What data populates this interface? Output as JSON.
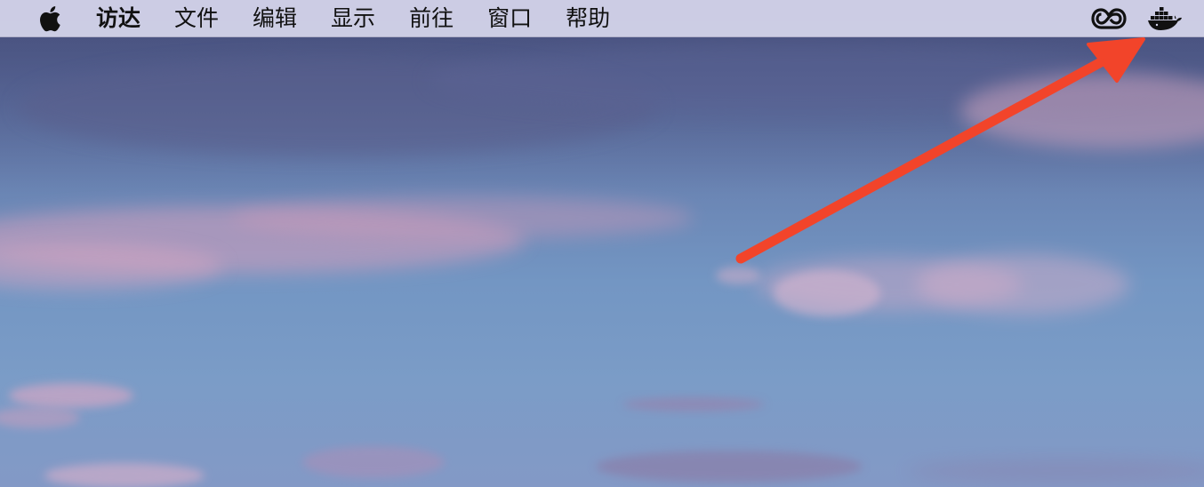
{
  "menubar": {
    "apple_menu_icon": "apple-logo-icon",
    "items": [
      {
        "label": "访达"
      },
      {
        "label": "文件"
      },
      {
        "label": "编辑"
      },
      {
        "label": "显示"
      },
      {
        "label": "前往"
      },
      {
        "label": "窗口"
      },
      {
        "label": "帮助"
      }
    ],
    "status_icons": [
      {
        "name": "creative-cloud-icon"
      },
      {
        "name": "docker-whale-icon"
      }
    ]
  },
  "desktop": {
    "wallpaper": "sunset-sky-with-pink-clouds"
  },
  "annotation": {
    "type": "arrow",
    "color": "#f2442a",
    "points_to": "docker-whale-icon"
  },
  "colors": {
    "menubar_bg": "#d6d6ec",
    "menu_text": "#111111",
    "sky_top": "#4f5a86",
    "sky_bottom": "#7b9cc7",
    "cloud_pink": "#d9a3bf",
    "arrow": "#f2442a"
  }
}
